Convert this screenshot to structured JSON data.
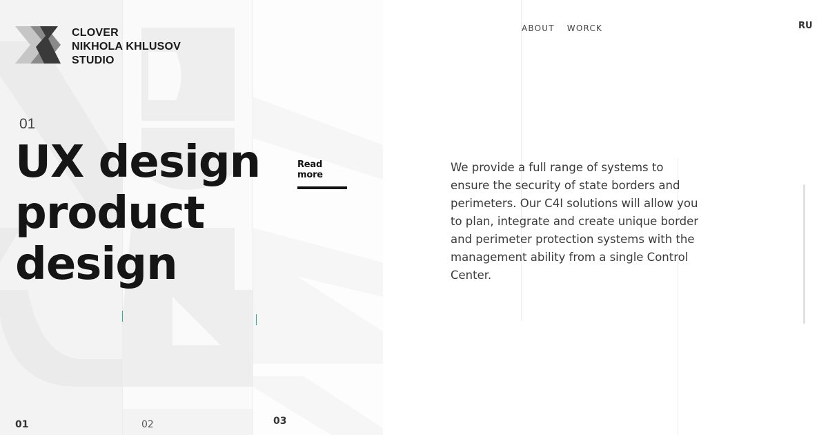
{
  "logo": {
    "line1": "CLOVER",
    "line2": "NIKHOLA KHLUSOV",
    "line3": "STUDIO",
    "mark_colors": [
      "#3a3a3a",
      "#8a8a8a",
      "#c6c6c6"
    ]
  },
  "nav": {
    "items": [
      {
        "label": "ABOUT"
      },
      {
        "label": "WORCK"
      }
    ],
    "lang": "RU"
  },
  "hero": {
    "slide_number": "01",
    "headline": [
      "UX design",
      "product",
      "design"
    ],
    "read_more": "Read more",
    "description": "We provide a full range of systems to ensure the security of state borders and perimeters. Our C4I solutions will allow you to plan, integrate and create unique border and perimeter protection systems with the management ability from a single Control Center."
  },
  "slides": {
    "tabs": [
      "01",
      "02",
      "03"
    ],
    "active_index": 0
  },
  "colors": {
    "accent": "#29b08f",
    "text": "#151515"
  }
}
